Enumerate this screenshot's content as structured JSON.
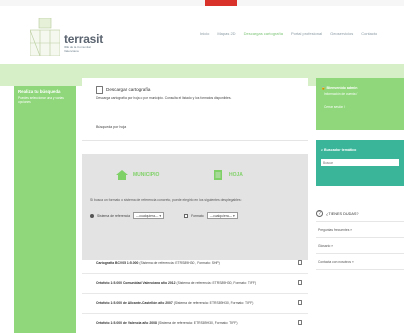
{
  "logo": {
    "title": "terrasit",
    "subtitle": "IDE de la Comunitat Valenciana"
  },
  "nav": {
    "items": [
      "Inicio",
      "Mapas 2D",
      "Descargas cartografía",
      "Portal profesional",
      "Geoservicios",
      "Contacto"
    ],
    "active_index": 2
  },
  "sidebar": {
    "title": "Realiza tu búsqueda",
    "description": "Puedes seleccionar una y varias opciones"
  },
  "main": {
    "download_title": "Descargar cartografía",
    "download_desc": "Descarga cartografía por hoja o por municipio. Consulta el listado y los formatos disponibles.",
    "search_link": "Búsqueda por hoja",
    "municipio_label": "MUNICIPIO",
    "hoja_label": "HOJA",
    "info_text": "Si busca un formato o sistema de referencia concreto, puede elegirlo en los siguientes desplegables:",
    "filter_ref_label": "Sistema de referencia",
    "filter_ref_value": "---cualquiera---",
    "filter_format_label": "Formato",
    "filter_format_value": "---cualquiera---",
    "rows": [
      {
        "bold": "Cartografía BCV05 1:5.000",
        "rest": " (Sistema de referencia: ETRS89H30 , Formato: SHP)"
      },
      {
        "bold": "Ortofoto 1:5.000 Comunidad Valenciana año 2012",
        "rest": " (Sistema de referencia: ETRS89H30, Formato: TIFF)"
      },
      {
        "bold": "Ortofoto 1:5.000 de Alicante-Castellón año 2007",
        "rest": " (Sistema de referencia: ETRS89H30, Formato: TIFF)"
      },
      {
        "bold": "Ortofoto 1:5.000 de Valencia año 2008",
        "rest": " (Sistema de referencia: ETRS89H30, Formato: TIFF)"
      }
    ]
  },
  "right": {
    "user_title": "Bienvenido admin",
    "user_link1": "Información de cuenta /",
    "user_link2": "Cerrar sesión /",
    "search_title": "Buscador temático",
    "search_placeholder": "Buscar",
    "faq_title": "¿TIENES DUDAS?",
    "faq_items": [
      "Preguntas frecuentes »",
      "Glosario »",
      "Contacta con nosotros »"
    ]
  },
  "colors": {
    "brand_green": "#8fd77a",
    "teal": "#3ab59a",
    "red_tab": "#d9322b"
  }
}
